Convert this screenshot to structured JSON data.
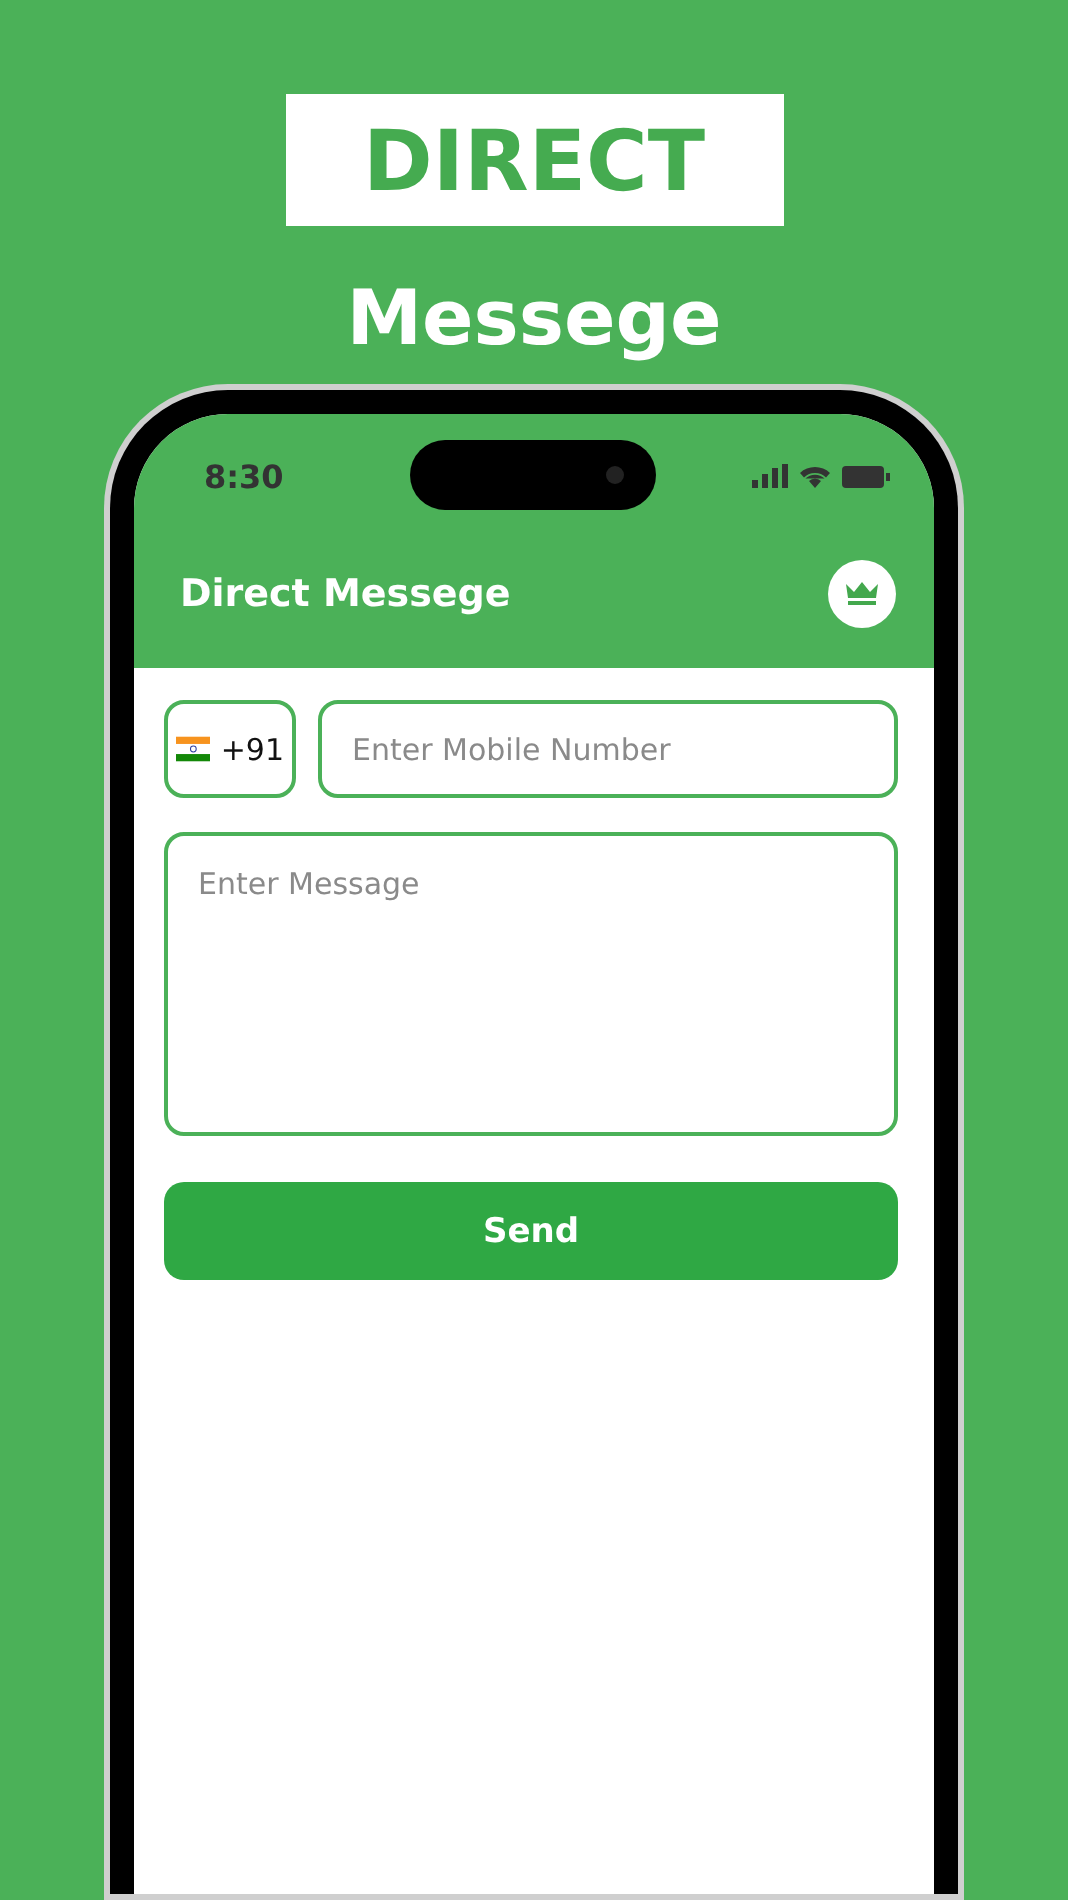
{
  "banner": {
    "badge": "DIRECT",
    "subtitle": "Messege"
  },
  "status_bar": {
    "time": "8:30"
  },
  "app_bar": {
    "title": "Direct Messege"
  },
  "form": {
    "country_code": "+91",
    "phone": {
      "placeholder": "Enter Mobile Number"
    },
    "message": {
      "placeholder": "Enter Message"
    },
    "send_button": "Send"
  }
}
